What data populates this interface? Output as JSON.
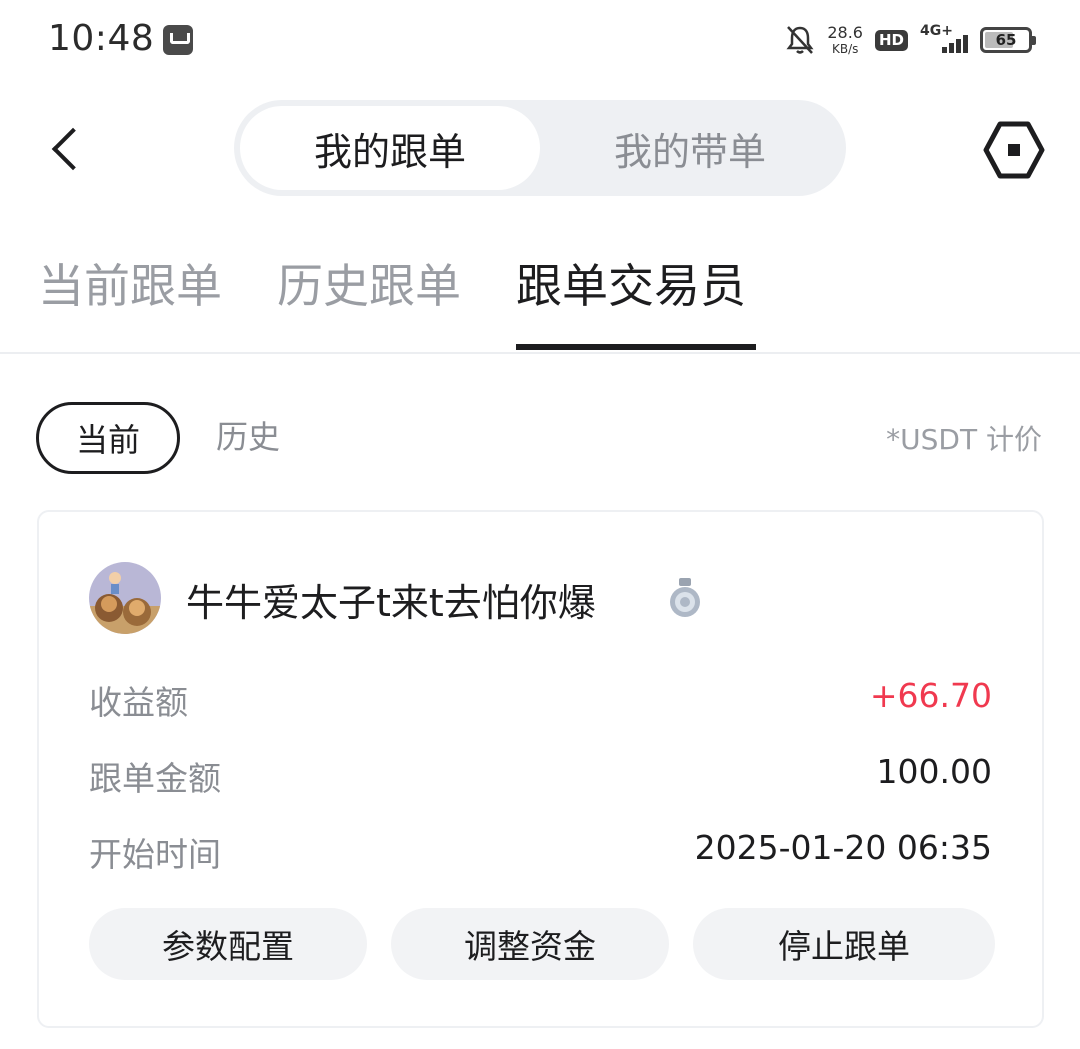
{
  "status_bar": {
    "time": "10:48",
    "net_speed_value": "28.6",
    "net_speed_unit": "KB/s",
    "hd_label": "HD",
    "signal_label": "4G+",
    "battery_level": "65",
    "icons": [
      "mail-icon",
      "mute-bell-icon",
      "signal-icon",
      "battery-icon"
    ]
  },
  "header": {
    "segments": [
      "我的跟单",
      "我的带单"
    ],
    "selected_segment": "我的跟单"
  },
  "tabs": {
    "items": [
      "当前跟单",
      "历史跟单",
      "跟单交易员"
    ],
    "active": "跟单交易员"
  },
  "filter": {
    "current_label": "当前",
    "history_label": "历史",
    "unit_note": "*USDT 计价"
  },
  "card": {
    "trader_name": "牛牛爱太子t来t去怕你爆",
    "rows": [
      {
        "label": "收益额",
        "value": "+66.70"
      },
      {
        "label": "跟单金额",
        "value": "100.00"
      },
      {
        "label": "开始时间",
        "value": "2025-01-20 06:35"
      }
    ],
    "buttons": [
      "参数配置",
      "调整资金",
      "停止跟单"
    ]
  },
  "colors": {
    "positive": "#f0394f",
    "text_primary": "#1d1d1f",
    "text_secondary": "#8a8d93",
    "segment_bg": "#eef0f3",
    "button_bg": "#f2f3f5"
  }
}
